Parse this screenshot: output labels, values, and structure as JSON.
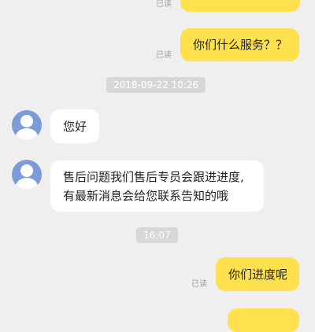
{
  "messages": {
    "out_top_read": "已读",
    "out_1": {
      "text": "你们什么服务？？",
      "read": "已读"
    },
    "time_1": "2018-09-22 10:26",
    "in_1": {
      "text": "您好"
    },
    "in_2": {
      "line1": "售后问题我们售后专员会跟进进度,",
      "line2": "有最新消息会给您联系告知的哦"
    },
    "time_2": "16:07",
    "out_2": {
      "text": "你们进度呢",
      "read": "已读"
    }
  },
  "icons": {
    "agent_avatar": "person-avatar-icon"
  },
  "colors": {
    "outgoing_bubble": "#ffe14d",
    "incoming_bubble": "#ffffff",
    "background": "#efefef",
    "avatar": "#7d9bd9"
  }
}
